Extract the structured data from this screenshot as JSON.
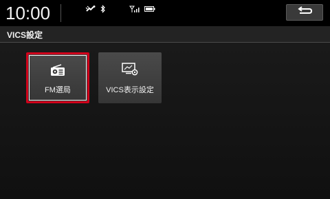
{
  "status_bar": {
    "time": "10:00",
    "icons": [
      "gps-signal-icon",
      "bluetooth-icon",
      "cell-signal-icon",
      "battery-icon"
    ]
  },
  "header": {
    "back_icon": "back-arrow-icon"
  },
  "title": "VICS設定",
  "tiles": [
    {
      "label": "FM選局",
      "icon": "radio-icon",
      "selected": true
    },
    {
      "label": "VICS表示設定",
      "icon": "map-settings-icon",
      "selected": false
    }
  ],
  "colors": {
    "selection": "#d0021b",
    "tile": "#404040",
    "background": "#141414"
  }
}
